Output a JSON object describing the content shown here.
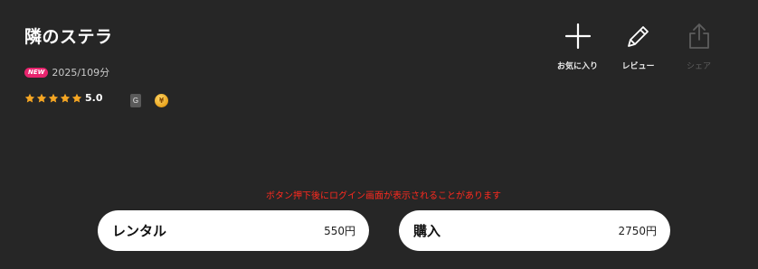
{
  "title": "隣のステラ",
  "meta": {
    "badge": "NEW",
    "info": "2025/109分"
  },
  "rating": {
    "value": "5.0",
    "stars": 5,
    "age_rating": "G",
    "coin_symbol": "¥"
  },
  "actions": [
    {
      "label": "お気に入り",
      "icon": "plus-icon",
      "enabled": true
    },
    {
      "label": "レビュー",
      "icon": "pencil-icon",
      "enabled": true
    },
    {
      "label": "シェア",
      "icon": "share-icon",
      "enabled": false
    }
  ],
  "notice": "ボタン押下後にログイン画面が表示されることがあります",
  "purchase": {
    "rental": {
      "label": "レンタル",
      "price": "550円"
    },
    "buy": {
      "label": "購入",
      "price": "2750円"
    }
  },
  "colors": {
    "background": "#262626",
    "badge": "#e8246e",
    "star": "#f5a623",
    "notice": "#ff2a1f",
    "disabled": "#5e5e5e"
  }
}
